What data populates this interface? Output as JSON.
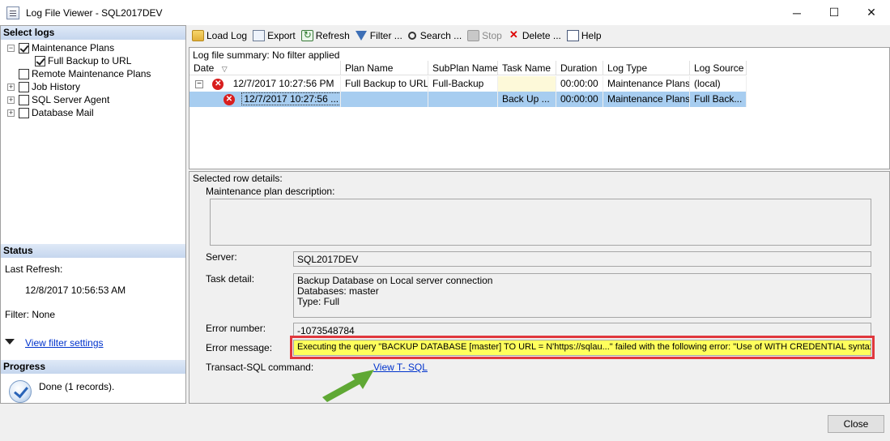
{
  "window": {
    "title": "Log File Viewer - SQL2017DEV",
    "minimize": "─",
    "maximize": "☐",
    "close": "✕"
  },
  "left": {
    "select_logs_header": "Select logs",
    "tree": [
      {
        "label": "Maintenance Plans",
        "expander": "−",
        "checked": true
      },
      {
        "label": "Full Backup to URL",
        "checked": true
      },
      {
        "label": "Remote Maintenance Plans",
        "checked": false
      },
      {
        "label": "Job History",
        "expander": "+",
        "checked": false
      },
      {
        "label": "SQL Server Agent",
        "expander": "+",
        "checked": false
      },
      {
        "label": "Database Mail",
        "expander": "+",
        "checked": false
      }
    ],
    "status_header": "Status",
    "last_refresh_label": "Last Refresh:",
    "last_refresh_value": "12/8/2017 10:56:53 AM",
    "filter_label": "Filter: None",
    "view_filter_link": "View filter settings",
    "progress_header": "Progress",
    "progress_text": "Done (1 records)."
  },
  "toolbar": {
    "load_log": "Load Log",
    "export": "Export",
    "refresh": "Refresh",
    "filter": "Filter ...",
    "search": "Search ...",
    "stop": "Stop",
    "delete": "Delete ...",
    "help": "Help"
  },
  "log": {
    "summary": "Log file summary: No filter applied",
    "columns": [
      "Date",
      "Plan Name",
      "SubPlan Name",
      "Task Name",
      "Duration",
      "Log Type",
      "Log Source"
    ],
    "rows": [
      {
        "date": "12/7/2017 10:27:56 PM",
        "plan": "Full Backup to URL",
        "subplan": "Full-Backup",
        "task": "",
        "duration": "00:00:00",
        "type": "Maintenance Plans",
        "source": "(local)"
      },
      {
        "date": "12/7/2017 10:27:56 ...",
        "plan": "",
        "subplan": "",
        "task": "Back Up ...",
        "duration": "00:00:00",
        "type": "Maintenance Plans",
        "source": "Full Back..."
      }
    ]
  },
  "details": {
    "header": "Selected row details:",
    "description_label": "Maintenance plan description:",
    "description_value": "",
    "server_label": "Server:",
    "server_value": "SQL2017DEV",
    "task_detail_label": "Task detail:",
    "task_detail_lines": [
      "Backup Database on Local server connection",
      "Databases: master",
      "Type: Full"
    ],
    "error_number_label": "Error number:",
    "error_number_value": "-1073548784",
    "error_message_label": "Error message:",
    "error_message_value": "Executing the query \"BACKUP DATABASE [master] TO  URL = N'https://sqlau...\" failed with the following error: \"Use of WITH CREDENTIAL syntax i",
    "tsql_label": "Transact-SQL command:",
    "tsql_link": "View T- SQL"
  },
  "footer": {
    "close_label": "Close"
  },
  "colors": {
    "highlight_row": "#a7cdf0",
    "error_field": "#ffff5c",
    "annotation_frame": "#e0383e",
    "annotation_arrow": "#5fa834"
  }
}
